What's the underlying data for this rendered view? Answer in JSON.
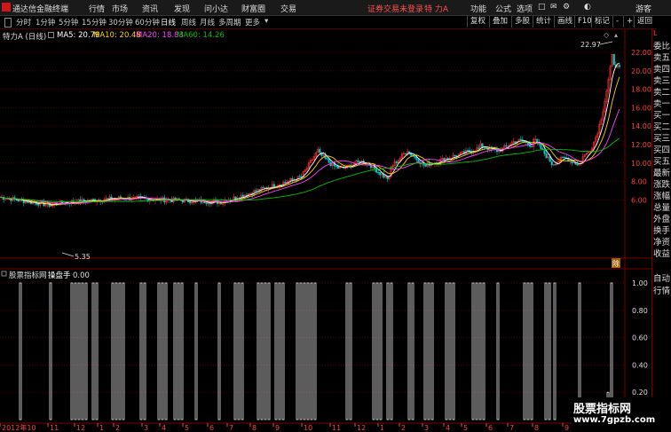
{
  "titlebar": {
    "app_name": "通达信金融终端",
    "menu": [
      "行情",
      "市场",
      "资讯",
      "发现",
      "问小达",
      "财富圈",
      "交易"
    ],
    "warning": "证券交易未登录",
    "stock": "特 力A",
    "right_menu": [
      "功能",
      "公式",
      "选项"
    ],
    "guest": "游客"
  },
  "toolbar": {
    "periods": [
      "分时",
      "1分钟",
      "5分钟",
      "15分钟",
      "30分钟",
      "60分钟",
      "日线",
      "周线",
      "月线",
      "多周期",
      "更多"
    ],
    "active_period": "日线",
    "buttons": [
      "复权",
      "叠加",
      "多股",
      "统计",
      "画线",
      "F10",
      "标记",
      "-",
      "+",
      "返回"
    ]
  },
  "infoline": {
    "stock_label": "特力A (日线)",
    "ma5": "MA5: 20.79",
    "ma10": "MA10: 20.48",
    "ma20": "MA20: 18.83",
    "ma60": "MA60: 14.26",
    "colors": {
      "ma5": "#ffffff",
      "ma10": "#ffd000",
      "ma20": "#ff40ff",
      "ma60": "#00c000"
    }
  },
  "price_axis": [
    "22.00",
    "20.00",
    "18.00",
    "16.00",
    "14.00",
    "12.00",
    "10.00",
    "8.00",
    "6.00"
  ],
  "annotations": {
    "high": "22.97",
    "low": "5.35"
  },
  "indicator": {
    "source": "股票指标网",
    "name": "操盘手",
    "value": "0.00",
    "axis": [
      "1.00",
      "0.80",
      "0.60",
      "0.40",
      "0.20"
    ]
  },
  "date_axis": [
    "2012年10",
    "11",
    "12",
    "1",
    "2",
    "3",
    "4",
    "5",
    "6",
    "7",
    "8",
    "9",
    "10",
    "11",
    "12",
    "1",
    "2",
    "3",
    "4",
    "5",
    "6",
    "7",
    "8",
    "9",
    "10",
    "11"
  ],
  "right_panel": {
    "top": [
      "L",
      "委比",
      "卖五",
      "卖四",
      "卖三",
      "卖二",
      "卖一",
      "买一",
      "买二",
      "买三",
      "买四",
      "买五",
      "最新",
      "涨跌",
      "涨幅",
      "总量",
      "外盘",
      "换手",
      "净资",
      "收益"
    ],
    "bottom": [
      "自动",
      "行情"
    ],
    "mark": "除"
  },
  "watermark": {
    "line1": "股票指标网",
    "line2": "www.7gpzb.com"
  }
}
